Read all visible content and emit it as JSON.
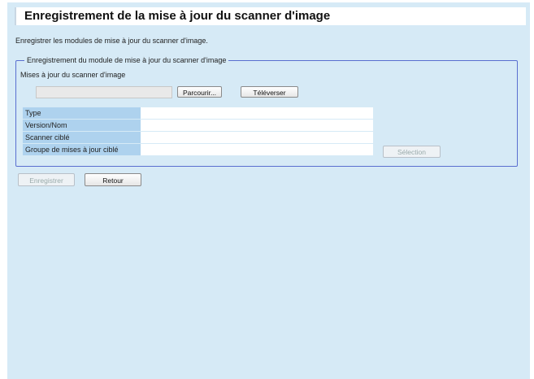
{
  "header": {
    "title": "Enregistrement de la mise à jour du scanner d'image"
  },
  "intro_text": "Enregistrer les modules de mise à jour du scanner d'image.",
  "fieldset": {
    "legend": "Enregistrement du module de mise à jour du scanner d'image",
    "file_label": "Mises à jour du scanner d'image",
    "file_value": "",
    "browse_label": "Parcourir...",
    "upload_label": "Téléverser"
  },
  "info_rows": [
    {
      "label": "Type",
      "value": ""
    },
    {
      "label": "Version/Nom",
      "value": ""
    },
    {
      "label": "Scanner ciblé",
      "value": ""
    },
    {
      "label": "Groupe de mises à jour ciblé",
      "value": ""
    }
  ],
  "select_label": "Sélection",
  "actions": {
    "register_label": "Enregistrer",
    "back_label": "Retour"
  }
}
